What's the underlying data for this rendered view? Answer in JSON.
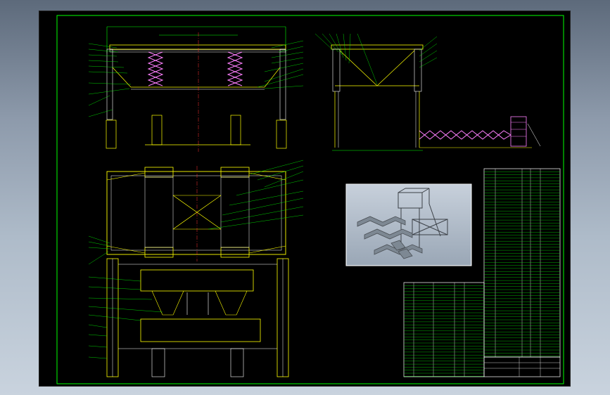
{
  "notes": {
    "title": "",
    "lines": []
  },
  "title_block": {
    "drawing_name": "",
    "drawing_no": ""
  },
  "colors": {
    "background": "#000000",
    "frame": "#00ff00",
    "structure": "#ffff00",
    "centerline": "#ff3030",
    "spring": "#ff80ff",
    "leader": "#00ff00"
  }
}
